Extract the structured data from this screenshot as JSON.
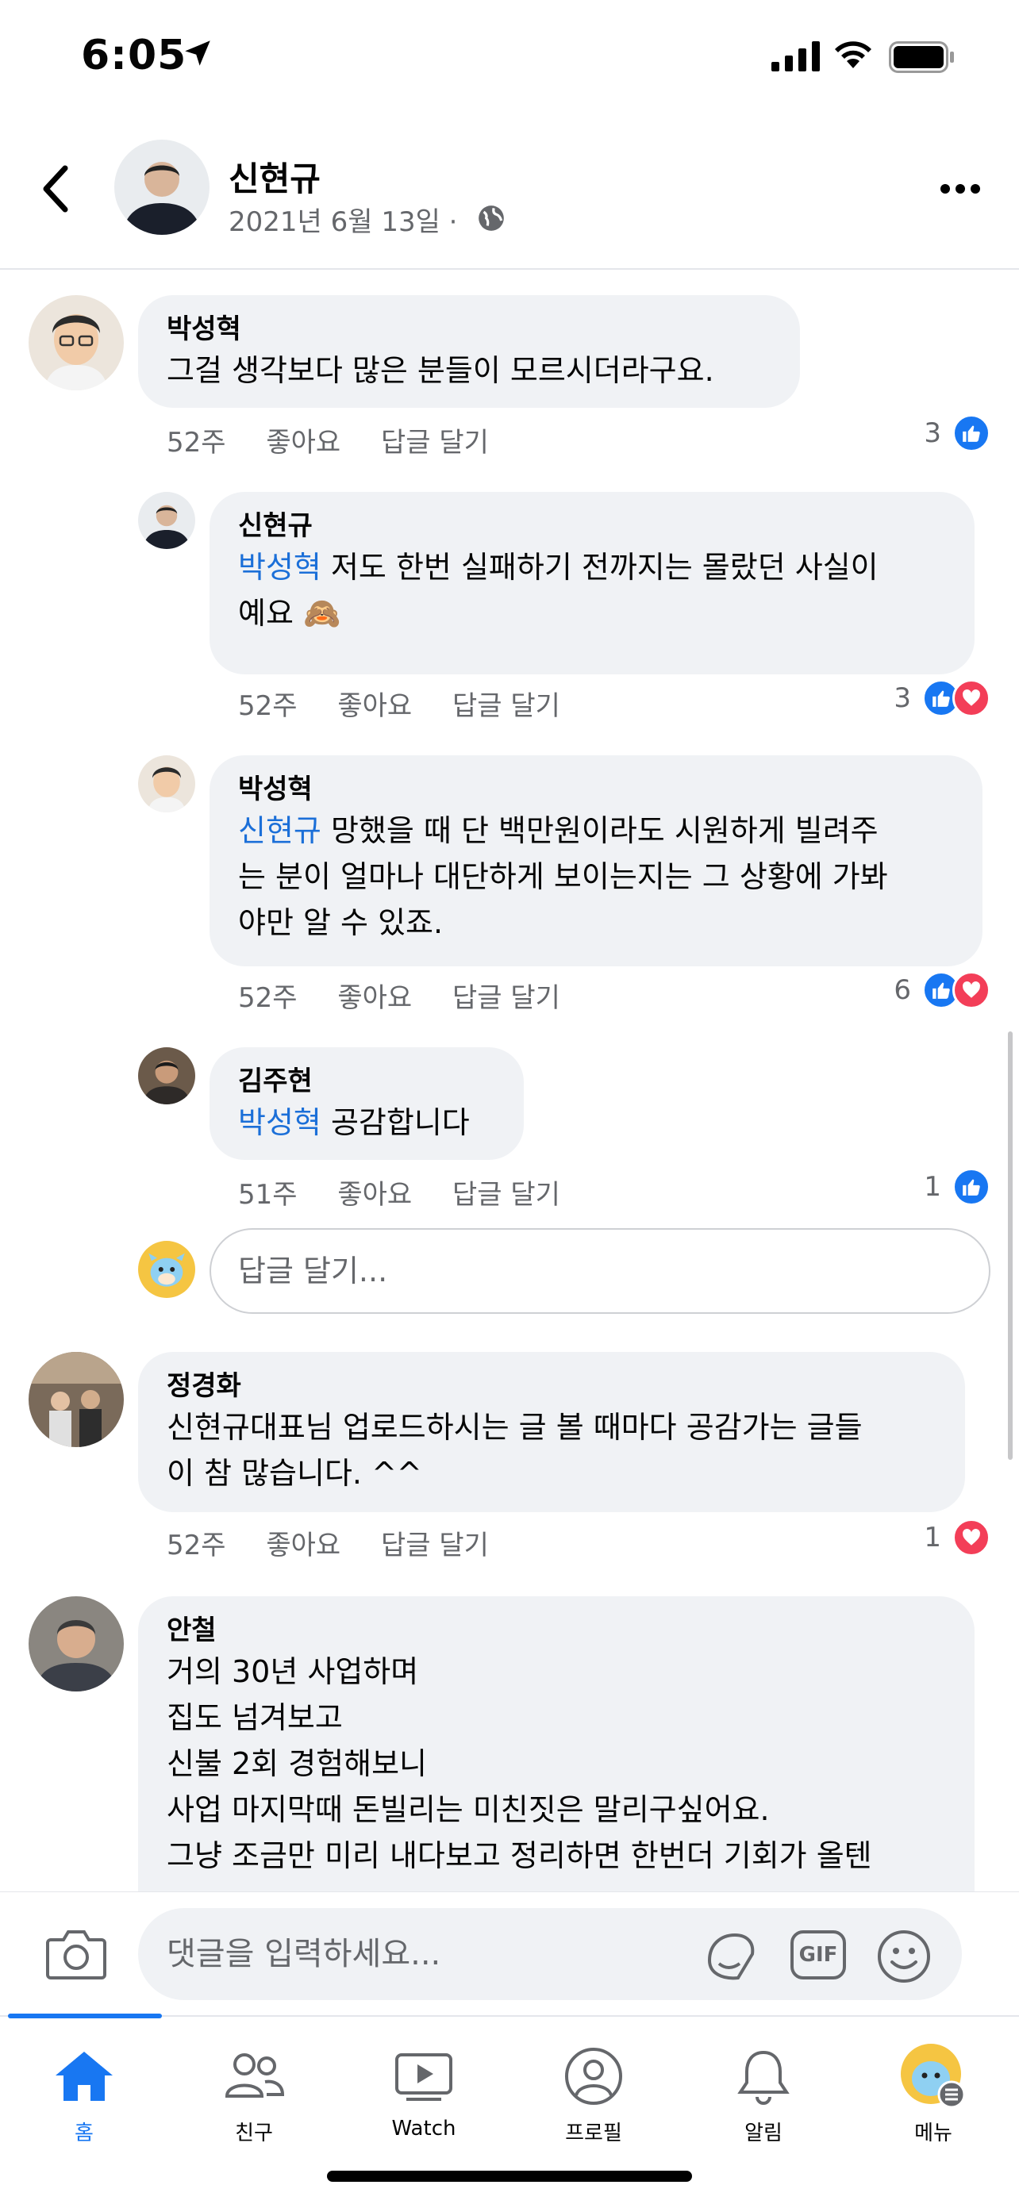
{
  "status_bar": {
    "time": "6:05"
  },
  "header": {
    "author": "신현규",
    "date": "2021년 6월 13일 ·"
  },
  "actions": {
    "like": "좋아요",
    "reply": "답글 달기"
  },
  "comments": [
    {
      "author": "박성혁",
      "mention": "",
      "lines": [
        "그걸 생각보다 많은 분들이 모르시더라구요."
      ],
      "age": "52주",
      "reaction_count": "3",
      "reactions": [
        "like"
      ]
    },
    {
      "author": "신현규",
      "mention": "박성혁",
      "lines": [
        " 저도 한번 실패하기 전까지는 몰랐던 사실이",
        "예요 🙈"
      ],
      "age": "52주",
      "reaction_count": "3",
      "reactions": [
        "like",
        "love"
      ]
    },
    {
      "author": "박성혁",
      "mention": "신현규",
      "lines": [
        " 망했을 때 단 백만원이라도 시원하게 빌려주",
        "는 분이 얼마나 대단하게 보이는지는 그 상황에 가봐",
        "야만 알 수 있죠."
      ],
      "age": "52주",
      "reaction_count": "6",
      "reactions": [
        "like",
        "love"
      ]
    },
    {
      "author": "김주현",
      "mention": "박성혁",
      "lines": [
        " 공감합니다"
      ],
      "age": "51주",
      "reaction_count": "1",
      "reactions": [
        "like"
      ]
    },
    {
      "author": "정경화",
      "mention": "",
      "lines": [
        "신현규대표님 업로드하시는 글 볼 때마다 공감가는 글들",
        "이 참 많습니다. ^^"
      ],
      "age": "52주",
      "reaction_count": "1",
      "reactions": [
        "love"
      ]
    },
    {
      "author": "안철",
      "mention": "",
      "lines": [
        "거의 30년 사업하며",
        "집도 넘겨보고",
        "신불 2회 경험해보니",
        "사업 마지막때 돈빌리는 미친짓은 말리구싶어요.",
        "그냥 조금만 미리 내다보고 정리하면 한번더 기회가 올텐"
      ]
    }
  ],
  "reply_input": {
    "placeholder": "답글 달기..."
  },
  "composer": {
    "placeholder": "댓글을 입력하세요...",
    "gif_label": "GIF"
  },
  "tabs": [
    {
      "label": "홈",
      "icon": "home-icon",
      "active": true
    },
    {
      "label": "친구",
      "icon": "friends-icon"
    },
    {
      "label": "Watch",
      "icon": "watch-icon"
    },
    {
      "label": "프로필",
      "icon": "profile-icon"
    },
    {
      "label": "알림",
      "icon": "bell-icon"
    },
    {
      "label": "메뉴",
      "icon": "menu-avatar-icon"
    }
  ],
  "colors": {
    "accent": "#1877f2",
    "mention": "#1b6fd8",
    "love": "#f33e58",
    "bubble": "#f0f2f5",
    "secondary_text": "#65676b"
  }
}
